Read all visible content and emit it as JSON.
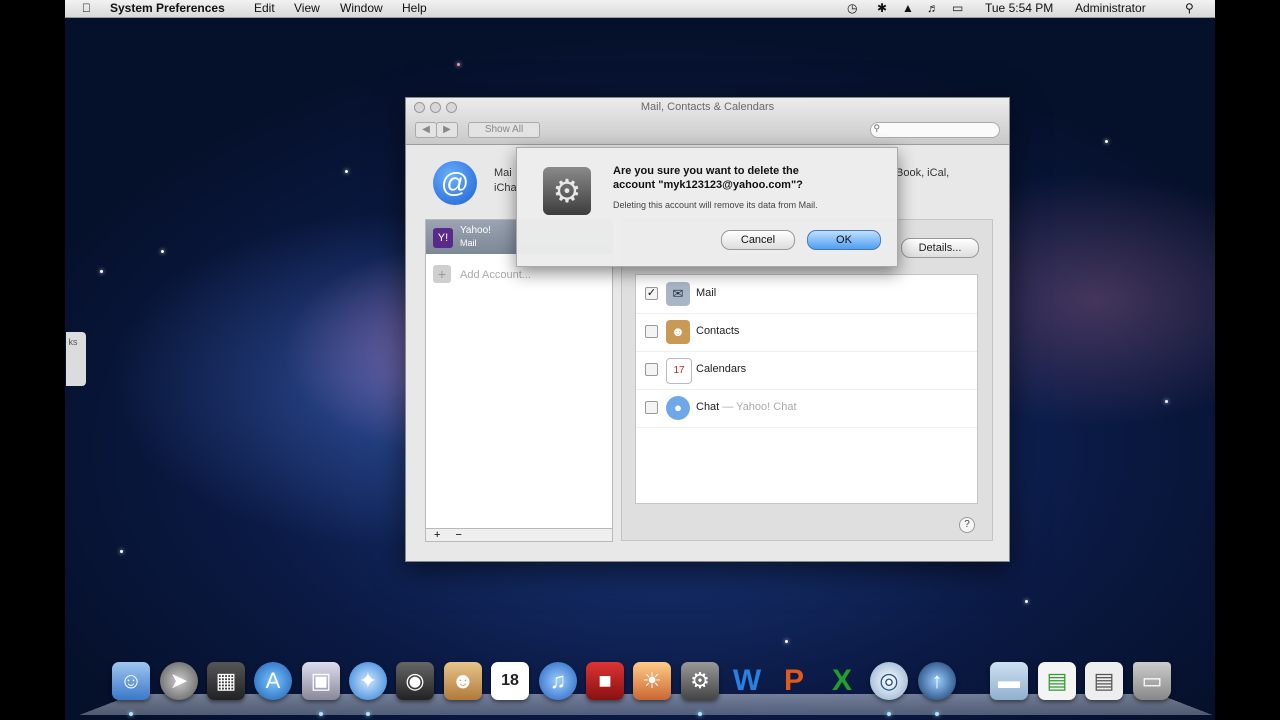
{
  "menubar": {
    "app": "System Preferences",
    "menus": [
      "Edit",
      "View",
      "Window",
      "Help"
    ],
    "clock": "Tue 5:54 PM",
    "user": "Administrator"
  },
  "window": {
    "title": "Mail, Contacts & Calendars",
    "show_all": "Show All",
    "back": "◀",
    "forward": "▶",
    "header_left_1": "Mai",
    "header_left_2": "iCha",
    "header_right": "Book, iCal,",
    "accounts": [
      {
        "name": "Yahoo!",
        "sub": "Mail",
        "selected": true
      }
    ],
    "add_account": "Add Account...",
    "details_button": "Details...",
    "services": [
      {
        "label": "Mail",
        "checked": true,
        "icon": "mail-icon"
      },
      {
        "label": "Contacts",
        "checked": false,
        "icon": "contacts-icon"
      },
      {
        "label": "Calendars",
        "checked": false,
        "icon": "calendar-icon"
      },
      {
        "label": "Chat",
        "suffix": "— Yahoo! Chat",
        "checked": false,
        "icon": "chat-icon"
      }
    ],
    "plus": "+",
    "minus": "−",
    "help": "?"
  },
  "dialog": {
    "question_line1": "Are you sure you want to delete the",
    "question_line2": "account \"myk123123@yahoo.com\"?",
    "informative": "Deleting this account will remove its data from Mail.",
    "cancel": "Cancel",
    "ok": "OK"
  },
  "dock": {
    "calendar_date": "18",
    "items": [
      "finder-icon",
      "launchpad-icon",
      "mission-control-icon",
      "app-store-icon",
      "preview-icon",
      "safari-icon",
      "facetime-icon",
      "contacts-icon",
      "calendar-icon",
      "itunes-icon",
      "photo-booth-icon",
      "iphoto-icon",
      "system-preferences-icon",
      "word-icon",
      "powerpoint-icon",
      "excel-icon",
      "dvd-player-icon",
      "utility-icon",
      "documents-folder-icon",
      "document-icon",
      "scanner-icon",
      "trash-icon"
    ]
  }
}
